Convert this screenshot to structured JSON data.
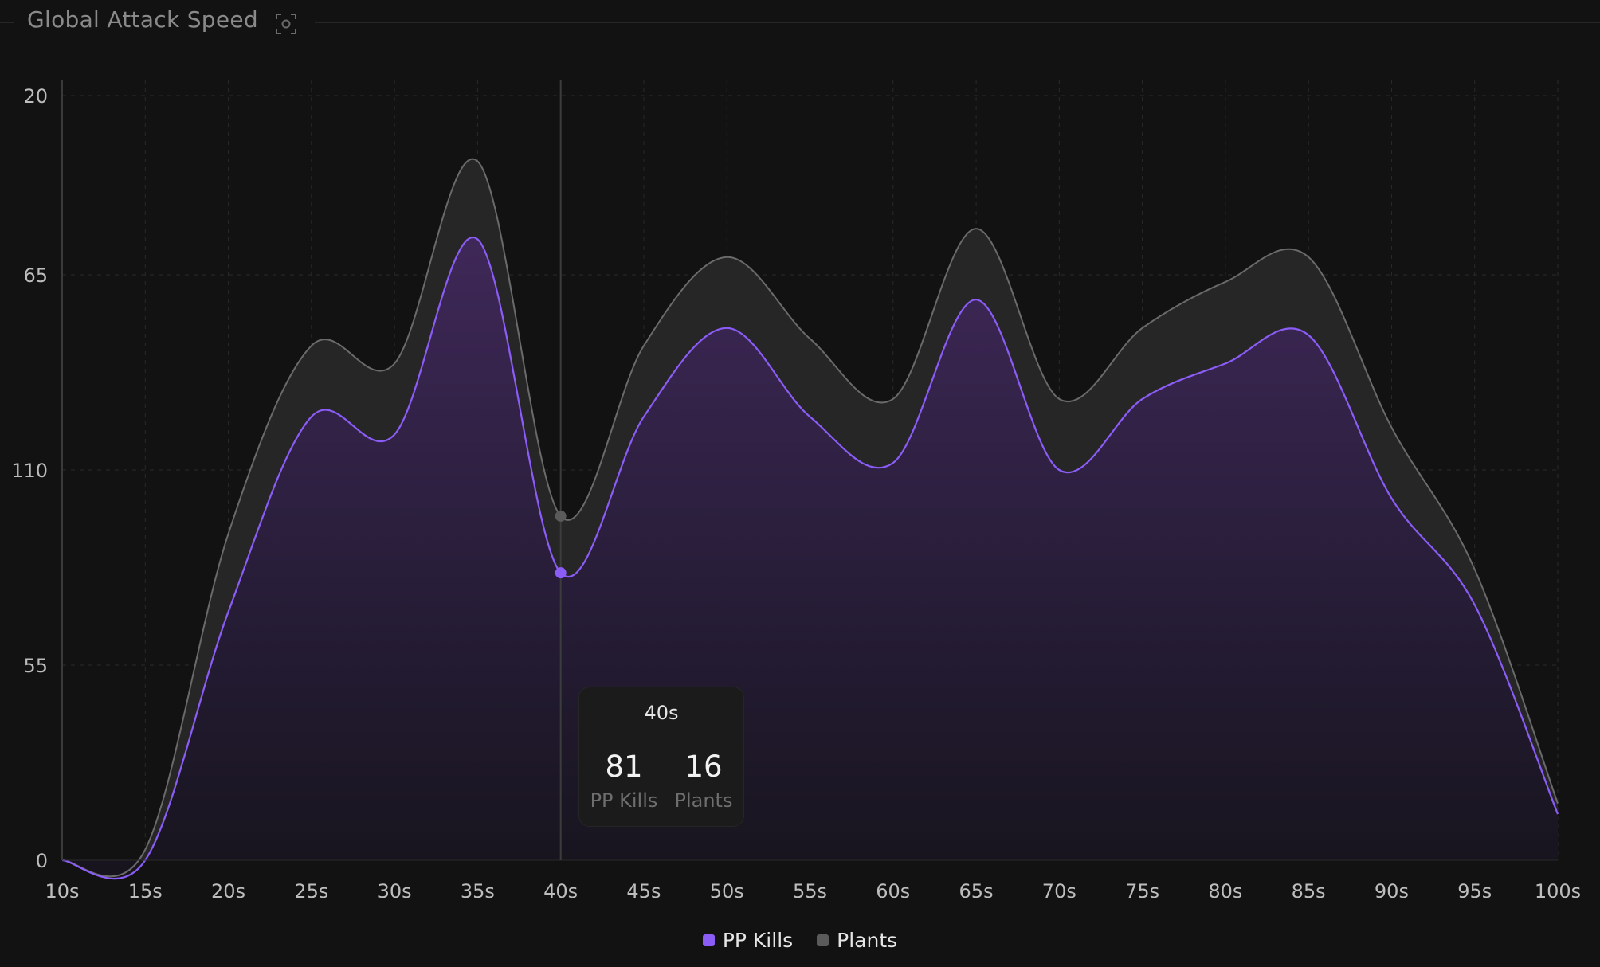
{
  "panel": {
    "title": "Global Attack Speed",
    "focus_icon": "focus-icon"
  },
  "colors": {
    "pp_kills": "#8b5cf6",
    "plants": "#5a5a5a",
    "background": "#121212"
  },
  "chart_data": {
    "type": "area",
    "title": "Global Attack Speed",
    "x": [
      "10s",
      "15s",
      "20s",
      "25s",
      "30s",
      "35s",
      "40s",
      "45s",
      "50s",
      "55s",
      "60s",
      "65s",
      "70s",
      "75s",
      "80s",
      "85s",
      "90s",
      "95s",
      "100s"
    ],
    "y_tick_labels": [
      "0",
      "55",
      "110",
      "65",
      "20"
    ],
    "stacked": true,
    "grid": true,
    "legend_position": "bottom-center",
    "series": [
      {
        "name": "PP Kills",
        "values": [
          0,
          0,
          70,
          125,
          120,
          175,
          81,
          125,
          150,
          125,
          112,
          158,
          110,
          130,
          140,
          148,
          102,
          72,
          13
        ]
      },
      {
        "name": "Plants",
        "values": [
          0,
          3,
          22,
          20,
          20,
          22,
          16,
          20,
          20,
          22,
          18,
          20,
          20,
          20,
          23,
          22,
          20,
          10,
          3
        ]
      }
    ]
  },
  "tooltip": {
    "x_label": "40s",
    "pp_kills_value": "81",
    "pp_kills_label": "PP Kills",
    "plants_value": "16",
    "plants_label": "Plants"
  },
  "legend": [
    {
      "label": "PP Kills",
      "color": "#8b5cf6"
    },
    {
      "label": "Plants",
      "color": "#5a5a5a"
    }
  ]
}
